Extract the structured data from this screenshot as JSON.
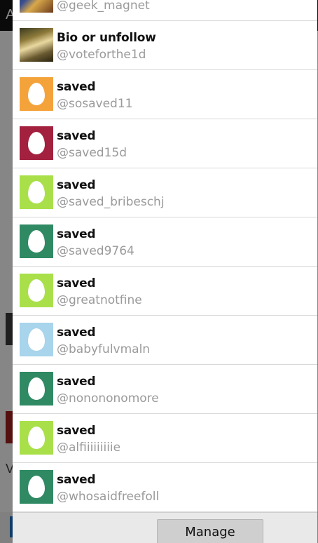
{
  "background": {
    "title_initial": "A",
    "side_letters": [
      "V"
    ]
  },
  "accounts": [
    {
      "name": "",
      "handle": "@geek_magnet",
      "avatar": "photo-geek",
      "avatar_color": ""
    },
    {
      "name": "Bio or unfollow",
      "handle": "@voteforthe1d",
      "avatar": "photo-vote",
      "avatar_color": ""
    },
    {
      "name": "saved",
      "handle": "@sosaved11",
      "avatar": "egg",
      "avatar_color": "#f4a33a"
    },
    {
      "name": "saved",
      "handle": "@saved15d",
      "avatar": "egg",
      "avatar_color": "#a3203f"
    },
    {
      "name": "saved",
      "handle": "@saved_bribeschj",
      "avatar": "egg",
      "avatar_color": "#a9e04a"
    },
    {
      "name": "saved",
      "handle": "@saved9764",
      "avatar": "egg",
      "avatar_color": "#2f8a64"
    },
    {
      "name": "saved",
      "handle": "@greatnotfine",
      "avatar": "egg",
      "avatar_color": "#a9e04a"
    },
    {
      "name": "saved",
      "handle": "@babyfulvmaln",
      "avatar": "egg",
      "avatar_color": "#a8d4ec"
    },
    {
      "name": "saved",
      "handle": "@nonononomore",
      "avatar": "egg",
      "avatar_color": "#2f8a64"
    },
    {
      "name": "saved",
      "handle": "@alfiiiiiiiiie",
      "avatar": "egg",
      "avatar_color": "#a9e04a"
    },
    {
      "name": "saved",
      "handle": "@whosaidfreefoll",
      "avatar": "egg",
      "avatar_color": "#2f8a64"
    }
  ],
  "footer": {
    "manage_label": "Manage"
  }
}
